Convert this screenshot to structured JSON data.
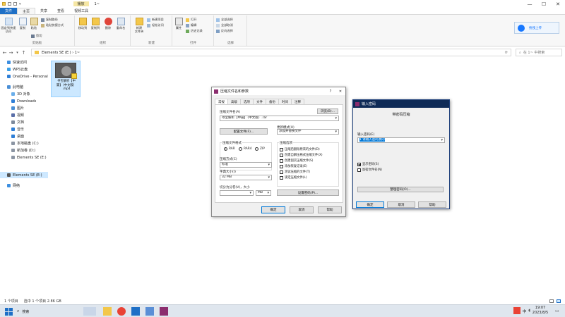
{
  "titlebar": {
    "context_tab": "播放",
    "path": "1~",
    "window_buttons": [
      "—",
      "☐",
      "✕"
    ]
  },
  "ribbon_tabs": [
    "文件",
    "主页",
    "共享",
    "查看",
    "视频工具"
  ],
  "ribbon": {
    "clipboard": {
      "label": "剪贴板",
      "pin": "固定到快速访问",
      "copy": "复制",
      "paste": "粘贴",
      "cut": "剪切",
      "copy_path": "复制路径",
      "paste_shortcut": "粘贴快捷方式"
    },
    "organize": {
      "label": "组织",
      "move_to": "移动到",
      "copy_to": "复制到",
      "delete": "删除",
      "rename": "重命名"
    },
    "new": {
      "label": "新建",
      "new_folder": "新建\n文件夹",
      "new_item": "新建项目",
      "easy_access": "轻松访问"
    },
    "open": {
      "label": "打开",
      "properties": "属性",
      "open": "打开",
      "edit": "编辑",
      "history": "历史记录"
    },
    "select": {
      "label": "选择",
      "select_all": "全部选择",
      "select_none": "全部取消",
      "invert": "反向选择"
    },
    "cloud_button": "拖拽上传"
  },
  "address": {
    "crumbs": "Elements SE (E:)  ›  1~",
    "search_placeholder": "在 1~ 中搜索"
  },
  "nav": [
    {
      "label": "快速访问",
      "color": "#3d8fe0",
      "level": 0
    },
    {
      "label": "WPS云盘",
      "color": "#3aa0e8",
      "level": 0
    },
    {
      "label": "OneDrive - Personal",
      "color": "#2f7fd7",
      "level": 0
    },
    {
      "label": "此电脑",
      "color": "#4a8fd6",
      "level": 0
    },
    {
      "label": "3D 对象",
      "color": "#6aaeea",
      "level": 1
    },
    {
      "label": "Downloads",
      "color": "#2f7fd7",
      "level": 1
    },
    {
      "label": "图片",
      "color": "#4a8fd6",
      "level": 1
    },
    {
      "label": "视频",
      "color": "#5a6fa8",
      "level": 1
    },
    {
      "label": "文档",
      "color": "#7d8a9c",
      "level": 1
    },
    {
      "label": "音乐",
      "color": "#2f7fd7",
      "level": 1
    },
    {
      "label": "桌面",
      "color": "#2f7fd7",
      "level": 1
    },
    {
      "label": "本地磁盘 (C:)",
      "color": "#8b95a3",
      "level": 1
    },
    {
      "label": "新加卷 (D:)",
      "color": "#8b95a3",
      "level": 1
    },
    {
      "label": "Elements SE (E:)",
      "color": "#8b95a3",
      "level": 1
    },
    {
      "label": "Elements SE (E:)",
      "color": "#555",
      "level": 0,
      "selected": true
    },
    {
      "label": "网络",
      "color": "#3d8fe0",
      "level": 0
    }
  ],
  "file": {
    "name_line1": "寻宝解析【中",
    "name_line2": "篇】（中文版）",
    "name_line3": ".mp4"
  },
  "status": {
    "count": "1 个项目",
    "selection": "选中 1 个项目  2.86 GB"
  },
  "winrar": {
    "title": "压缩文件名和参数",
    "help_btn": "?",
    "close_btn": "✕",
    "tabs": [
      "常规",
      "高级",
      "选项",
      "文件",
      "备份",
      "时间",
      "注释"
    ],
    "archive_name_label": "压缩文件名(A)",
    "browse": "浏览(B)...",
    "archive_name": "寻宝解析【中篇】（中文版）.rar",
    "profiles": "配置文件(F)...",
    "update_mode_label": "更新模式(U)",
    "update_mode": "添加并替换文件",
    "format_label": "压缩文件格式",
    "formats": [
      "RAR",
      "RAR4",
      "ZIP"
    ],
    "method_label": "压缩方式(C)",
    "method": "标准",
    "dict_label": "字典大小(I)",
    "dict": "32 MB",
    "split_label": "切分为分卷(V)，大小",
    "split_unit": "MB",
    "options_label": "压缩选项",
    "options": [
      {
        "label": "压缩后删除原来的文件(D)",
        "checked": false
      },
      {
        "label": "创建自解压格式压缩文件(X)",
        "checked": false
      },
      {
        "label": "创建固实压缩文件(S)",
        "checked": false
      },
      {
        "label": "添加恢复记录(E)",
        "checked": false
      },
      {
        "label": "测试压缩的文件(T)",
        "checked": false
      },
      {
        "label": "锁定压缩文件(L)",
        "checked": false
      }
    ],
    "set_password": "设置密码(P)...",
    "ok": "确定",
    "cancel": "取消",
    "help": "帮助"
  },
  "password": {
    "title": "输入密码",
    "subtitle": "带密码压缩",
    "enter_label": "输入密码(E)",
    "value": "1 请输入密码我的",
    "show_password": "显示密码(S)",
    "encrypt_names": "加密文件名(N)",
    "manage": "整理密码(O)...",
    "ok": "确定",
    "cancel": "取消",
    "help": "帮助"
  },
  "taskbar": {
    "search": "搜索",
    "time": "19:07",
    "date": "2023/8/5",
    "ime": "中",
    "lang": "英"
  }
}
